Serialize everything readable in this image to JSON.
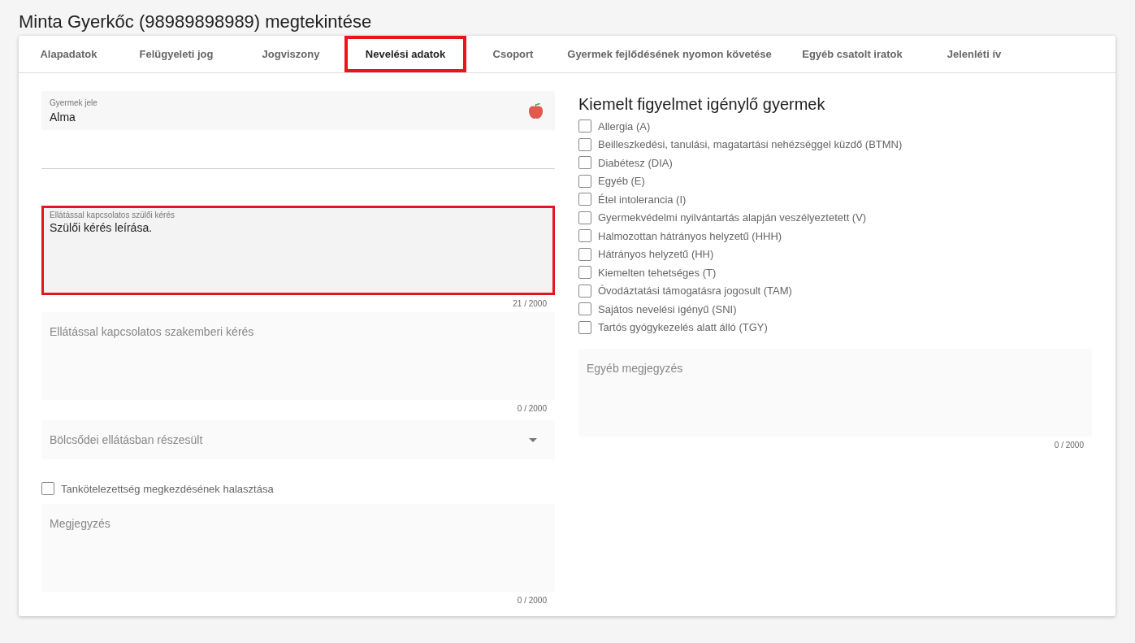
{
  "page": {
    "title": "Minta Gyerkőc (98989898989) megtekintése"
  },
  "tabs": [
    {
      "label": "Alapadatok",
      "selected": false,
      "highlighted": false
    },
    {
      "label": "Felügyeleti jog",
      "selected": false,
      "highlighted": false
    },
    {
      "label": "Jogviszony",
      "selected": false,
      "highlighted": false
    },
    {
      "label": "Nevelési adatok",
      "selected": true,
      "highlighted": true
    },
    {
      "label": "Csoport",
      "selected": false,
      "highlighted": false
    },
    {
      "label": "Gyermek fejlődésének nyomon követése",
      "selected": false,
      "highlighted": false
    },
    {
      "label": "Egyéb csatolt iratok",
      "selected": false,
      "highlighted": false
    },
    {
      "label": "Jelenléti ív",
      "selected": false,
      "highlighted": false
    }
  ],
  "left_fields": [
    {
      "kind": "text",
      "label": "Gyermek jele",
      "value": "Alma"
    },
    {
      "kind": "blank"
    },
    {
      "kind": "textarea",
      "label": "Ellátással kapcsolatos szülői kérés",
      "value": "Szülői kérés leírása.",
      "counter": "21 / 2000",
      "highlighted": true
    },
    {
      "kind": "textarea",
      "placeholder": "Ellátással kapcsolatos szakemberi kérés",
      "counter": "0 / 2000",
      "highlighted": false
    },
    {
      "kind": "select",
      "placeholder": "Bölcsődei ellátásban részesült"
    },
    {
      "kind": "checkbox",
      "label": "Tankötelezettség megkezdésének halasztása",
      "checked": false
    },
    {
      "kind": "textarea",
      "placeholder": "Megjegyzés",
      "counter": "0 / 2000",
      "highlighted": false
    }
  ],
  "special_needs": {
    "heading": "Kiemelt figyelmet igénylő gyermek",
    "options": [
      {
        "label": "Allergia (A)",
        "checked": false
      },
      {
        "label": "Beilleszkedési, tanulási, magatartási nehézséggel küzdő (BTMN)",
        "checked": false
      },
      {
        "label": "Diabétesz (DIA)",
        "checked": false
      },
      {
        "label": "Egyéb (E)",
        "checked": false
      },
      {
        "label": "Étel intolerancia (I)",
        "checked": false
      },
      {
        "label": "Gyermekvédelmi nyilvántartás alapján veszélyeztetett (V)",
        "checked": false
      },
      {
        "label": "Halmozottan hátrányos helyzetű (HHH)",
        "checked": false
      },
      {
        "label": "Hátrányos helyzetű (HH)",
        "checked": false
      },
      {
        "label": "Kiemelten tehetséges (T)",
        "checked": false
      },
      {
        "label": "Óvodáztatási támogatásra jogosult (TAM)",
        "checked": false
      },
      {
        "label": "Sajátos nevelési igényű (SNI)",
        "checked": false
      },
      {
        "label": "Tartós gyógykezelés alatt álló (TGY)",
        "checked": false
      }
    ],
    "note": {
      "placeholder": "Egyéb megjegyzés",
      "counter": "0 / 2000"
    }
  }
}
